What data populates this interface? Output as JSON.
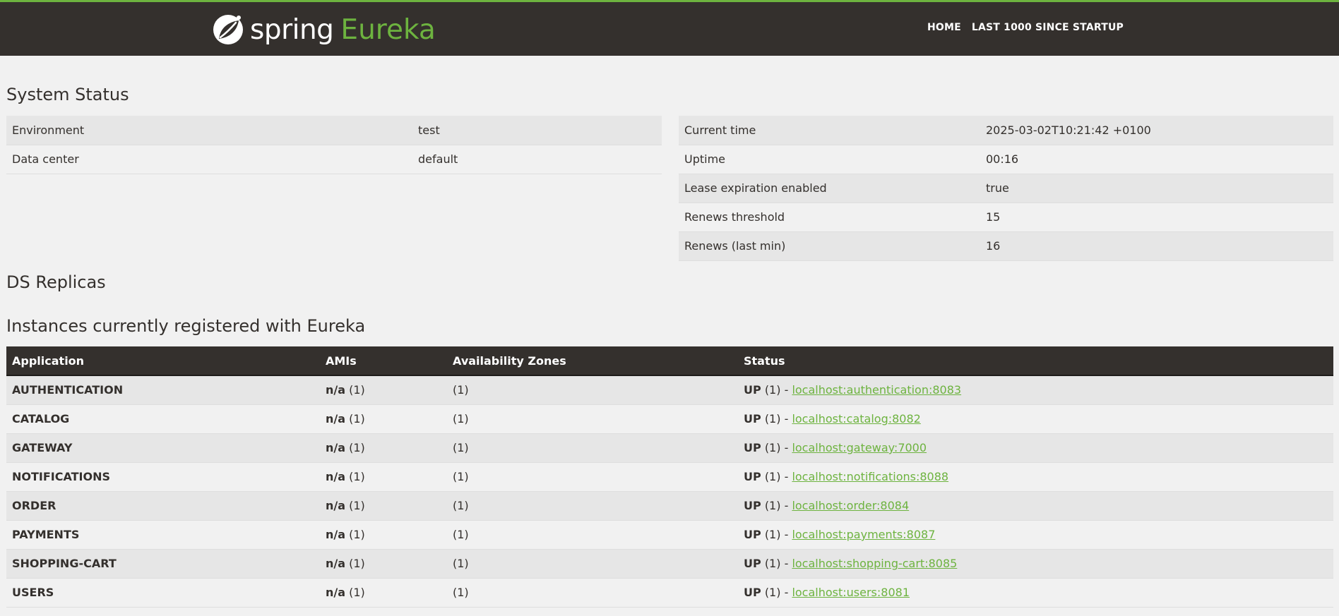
{
  "nav": {
    "brand_spring": "spring",
    "brand_eureka": "Eureka",
    "home": "HOME",
    "last1000": "LAST 1000 SINCE STARTUP"
  },
  "system_status": {
    "title": "System Status",
    "left": [
      {
        "label": "Environment",
        "value": "test"
      },
      {
        "label": "Data center",
        "value": "default"
      }
    ],
    "right": [
      {
        "label": "Current time",
        "value": "2025-03-02T10:21:42 +0100"
      },
      {
        "label": "Uptime",
        "value": "00:16"
      },
      {
        "label": "Lease expiration enabled",
        "value": "true"
      },
      {
        "label": "Renews threshold",
        "value": "15"
      },
      {
        "label": "Renews (last min)",
        "value": "16"
      }
    ]
  },
  "ds_replicas": {
    "title": "DS Replicas"
  },
  "instances": {
    "title": "Instances currently registered with Eureka",
    "headers": [
      "Application",
      "AMIs",
      "Availability Zones",
      "Status"
    ],
    "rows": [
      {
        "app": "AUTHENTICATION",
        "ami": "n/a",
        "ami_count": "(1)",
        "zones": "(1)",
        "status": "UP",
        "status_count": "(1) -",
        "link": "localhost:authentication:8083"
      },
      {
        "app": "CATALOG",
        "ami": "n/a",
        "ami_count": "(1)",
        "zones": "(1)",
        "status": "UP",
        "status_count": "(1) -",
        "link": "localhost:catalog:8082"
      },
      {
        "app": "GATEWAY",
        "ami": "n/a",
        "ami_count": "(1)",
        "zones": "(1)",
        "status": "UP",
        "status_count": "(1) -",
        "link": "localhost:gateway:7000"
      },
      {
        "app": "NOTIFICATIONS",
        "ami": "n/a",
        "ami_count": "(1)",
        "zones": "(1)",
        "status": "UP",
        "status_count": "(1) -",
        "link": "localhost:notifications:8088"
      },
      {
        "app": "ORDER",
        "ami": "n/a",
        "ami_count": "(1)",
        "zones": "(1)",
        "status": "UP",
        "status_count": "(1) -",
        "link": "localhost:order:8084"
      },
      {
        "app": "PAYMENTS",
        "ami": "n/a",
        "ami_count": "(1)",
        "zones": "(1)",
        "status": "UP",
        "status_count": "(1) -",
        "link": "localhost:payments:8087"
      },
      {
        "app": "SHOPPING-CART",
        "ami": "n/a",
        "ami_count": "(1)",
        "zones": "(1)",
        "status": "UP",
        "status_count": "(1) -",
        "link": "localhost:shopping-cart:8085"
      },
      {
        "app": "USERS",
        "ami": "n/a",
        "ami_count": "(1)",
        "zones": "(1)",
        "status": "UP",
        "status_count": "(1) -",
        "link": "localhost:users:8081"
      }
    ]
  },
  "colors": {
    "accent": "#6db33f",
    "dark": "#34302d",
    "row_alt": "#e6e6e6",
    "background": "#f1f1f1"
  }
}
